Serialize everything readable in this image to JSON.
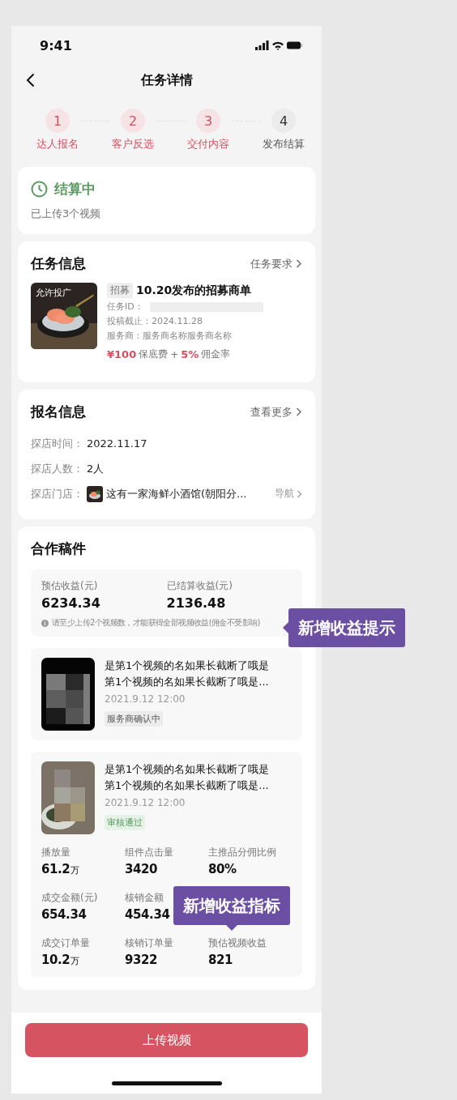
{
  "status_bar": {
    "time": "9:41"
  },
  "nav": {
    "title": "任务详情"
  },
  "steps": [
    {
      "number": "1",
      "label": "达人报名",
      "done": true
    },
    {
      "number": "2",
      "label": "客户反选",
      "done": true
    },
    {
      "number": "3",
      "label": "交付内容",
      "done": true
    },
    {
      "number": "4",
      "label": "发布结算",
      "done": false
    }
  ],
  "status_card": {
    "title": "结算中",
    "subtitle": "已上传3个视频"
  },
  "task_info": {
    "title": "任务信息",
    "link": "任务要求",
    "image_badge": "允许投广",
    "tag": "招募",
    "name": "10.20发布的招募商单",
    "id_label": "任务ID：",
    "deadline": "投稿截止：2024.11.28",
    "provider": "服务商：服务商名称服务商名称",
    "fee": "¥100",
    "fee_label": "保底费",
    "plus": "+",
    "rate": "5%",
    "rate_label": "佣金率"
  },
  "signup_info": {
    "title": "报名信息",
    "link": "查看更多",
    "rows": [
      {
        "label": "探店时间：",
        "value": "2022.11.17",
        "kind": "text"
      },
      {
        "label": "探店人数：",
        "value": "2人",
        "kind": "text"
      },
      {
        "label": "探店门店：",
        "value": "这有一家海鲜小酒馆(朝阳分...",
        "kind": "store",
        "action": "导航"
      }
    ]
  },
  "works": {
    "title": "合作稿件",
    "earnings": [
      {
        "label": "预估收益(元)",
        "value": "6234.34"
      },
      {
        "label": "已结算收益(元)",
        "value": "2136.48"
      }
    ],
    "tip": "请至少上传2个视频数，才能获得全部视频收益(佣金不受影响)",
    "videos": [
      {
        "title": "是第1个视频的名如果长截断了哦是第1个视频的名如果长截断了哦是...",
        "time": "2021.9.12 12:00",
        "status": "服务商确认中",
        "approved": false
      },
      {
        "title": "是第1个视频的名如果长截断了哦是第1个视频的名如果长截断了哦是...",
        "time": "2021.9.12 12:00",
        "status": "审核通过",
        "approved": true,
        "metric_rows": [
          [
            {
              "label": "播放量",
              "value": "61.2",
              "unit": "万"
            },
            {
              "label": "组件点击量",
              "value": "3420"
            },
            {
              "label": "主推品分佣比例",
              "value": "80%"
            }
          ],
          [
            {
              "label": "成交金额(元)",
              "value": "654.34"
            },
            {
              "label": "核销金额",
              "value": "454.34"
            }
          ],
          [
            {
              "label": "成交订单量",
              "value": "10.2",
              "unit": "万"
            },
            {
              "label": "核销订单量",
              "value": "9322"
            },
            {
              "label": "预估视频收益",
              "value": "821"
            }
          ]
        ]
      }
    ]
  },
  "upload_button": "上传视频",
  "annotations": [
    {
      "text": "新增收益提示"
    },
    {
      "text": "新增收益指标"
    }
  ]
}
